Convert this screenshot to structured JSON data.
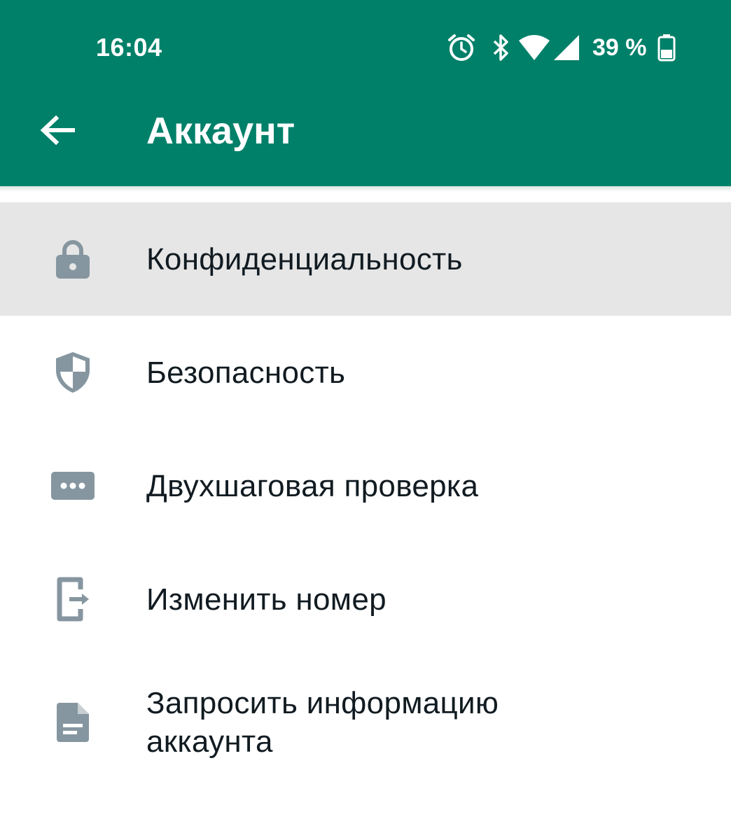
{
  "status_bar": {
    "time": "16:04",
    "battery": "39 %",
    "icons": [
      "alarm-icon",
      "bluetooth-icon",
      "wifi-icon",
      "cell-signal-icon",
      "battery-icon"
    ]
  },
  "toolbar": {
    "back_icon": "arrow-left-icon",
    "title": "Аккаунт"
  },
  "colors": {
    "header": "#008069",
    "icon_gray": "#8696a0",
    "text": "#111b21",
    "pressed_row": "#e6e6e6"
  },
  "menu": {
    "items": [
      {
        "label": "Конфиденциальность",
        "icon": "lock-icon"
      },
      {
        "label": "Безопасность",
        "icon": "shield-icon"
      },
      {
        "label": "Двухшаговая проверка",
        "icon": "password-dots-icon"
      },
      {
        "label": "Изменить номер",
        "icon": "change-number-icon"
      },
      {
        "label": "Запросить информацию аккаунта",
        "icon": "document-icon"
      }
    ]
  }
}
